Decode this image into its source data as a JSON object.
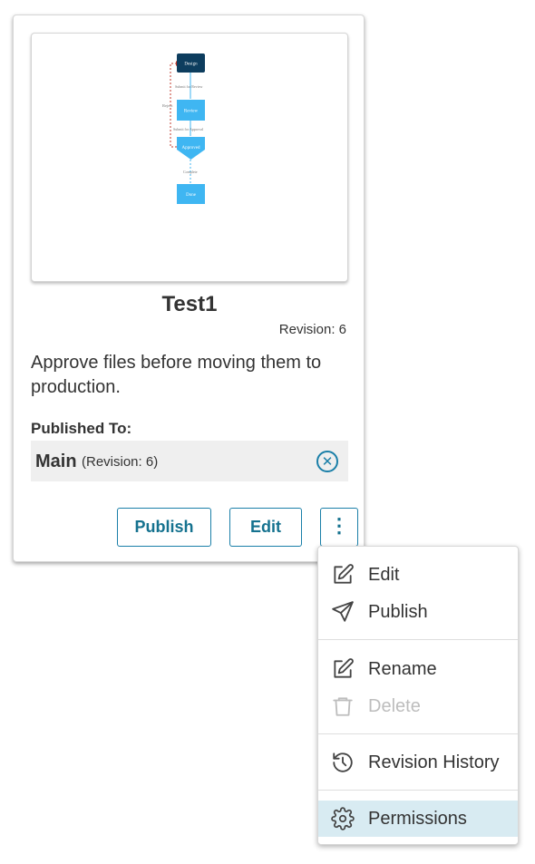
{
  "card": {
    "title": "Test1",
    "revision_label": "Revision: 6",
    "description": "Approve files before moving them to production.",
    "published_to_label": "Published To:",
    "published": {
      "name": "Main",
      "revision": "(Revision: 6)"
    },
    "publish_button": "Publish",
    "edit_button": "Edit",
    "more_button": "⋮"
  },
  "workflow_preview": {
    "nodes": [
      "Design",
      "Review",
      "Approved",
      "Done"
    ],
    "edges": [
      "Submit for Review",
      "Submit for Approval",
      "Complete"
    ],
    "reject_label": "Reject"
  },
  "menu": {
    "items": [
      {
        "label": "Edit",
        "icon": "edit-icon",
        "enabled": true
      },
      {
        "label": "Publish",
        "icon": "send-icon",
        "enabled": true
      },
      {
        "label": "Rename",
        "icon": "edit-icon",
        "enabled": true
      },
      {
        "label": "Delete",
        "icon": "trash-icon",
        "enabled": false
      },
      {
        "label": "Revision History",
        "icon": "history-icon",
        "enabled": true
      },
      {
        "label": "Permissions",
        "icon": "gear-icon",
        "enabled": true,
        "selected": true
      }
    ]
  },
  "colors": {
    "accent": "#1a7fa8",
    "node_dark": "#0d3d5e",
    "node_light": "#3fb6f2",
    "reject_line": "#c0392b",
    "menu_selected": "#d8ebf2"
  }
}
